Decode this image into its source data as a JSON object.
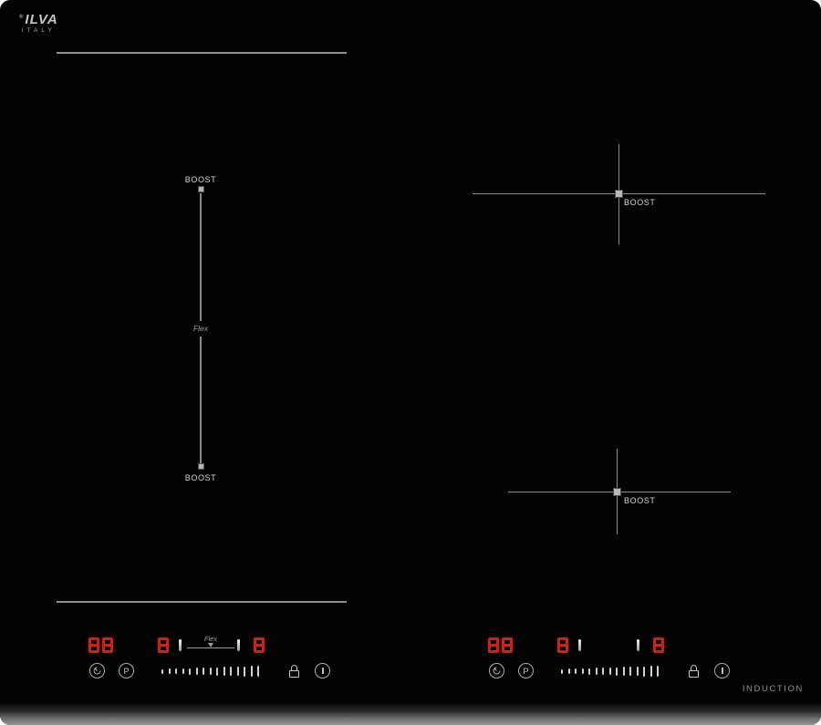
{
  "brand": {
    "registered_mark": "®",
    "name": "ILVA",
    "country": "ITALY"
  },
  "cooktop": {
    "type_label": "INDUCTION",
    "flex_zone": {
      "boost_top_label": "BOOST",
      "boost_bottom_label": "BOOST",
      "flex_label": "Flex"
    },
    "zone_top_right": {
      "boost_label": "BOOST"
    },
    "zone_bottom_right": {
      "boost_label": "BOOST"
    }
  },
  "panels": [
    {
      "name": "left-control-panel",
      "timer_display": "88",
      "zone_a_display": "8",
      "zone_b_display": "8",
      "flex_link_label": "Flex",
      "boost_button_label": "P",
      "slider_tick_count": 15
    },
    {
      "name": "right-control-panel",
      "timer_display": "88",
      "zone_a_display": "8",
      "zone_b_display": "8",
      "boost_button_label": "P",
      "slider_tick_count": 15
    }
  ],
  "colors": {
    "led_red": "#c1271d",
    "line_gray": "#8f8f8f",
    "label_gray": "#d2d2d2",
    "bevel_gray": "#949494"
  }
}
